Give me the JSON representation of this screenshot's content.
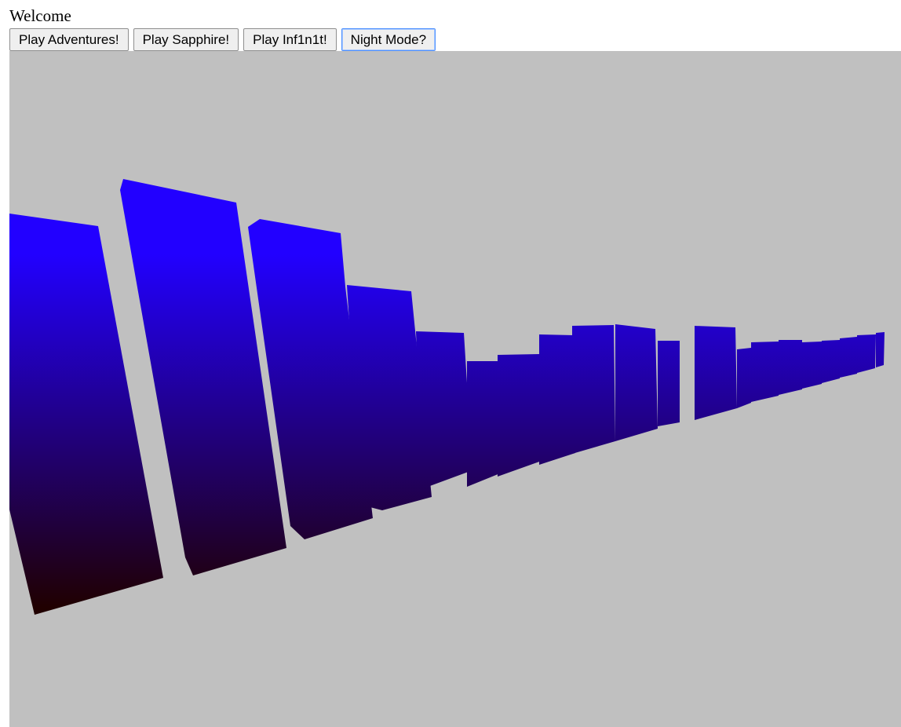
{
  "header": {
    "welcome_text": "Welcome"
  },
  "toolbar": {
    "buttons": [
      {
        "label": "Play Adventures!"
      },
      {
        "label": "Play Sapphire!"
      },
      {
        "label": "Play Inf1n1t!"
      },
      {
        "label": "Night Mode?"
      }
    ]
  },
  "scene": {
    "background_color": "#c0c0c0",
    "gradient_top_color": "#2200ff",
    "gradient_bottom_color": "#200000"
  }
}
